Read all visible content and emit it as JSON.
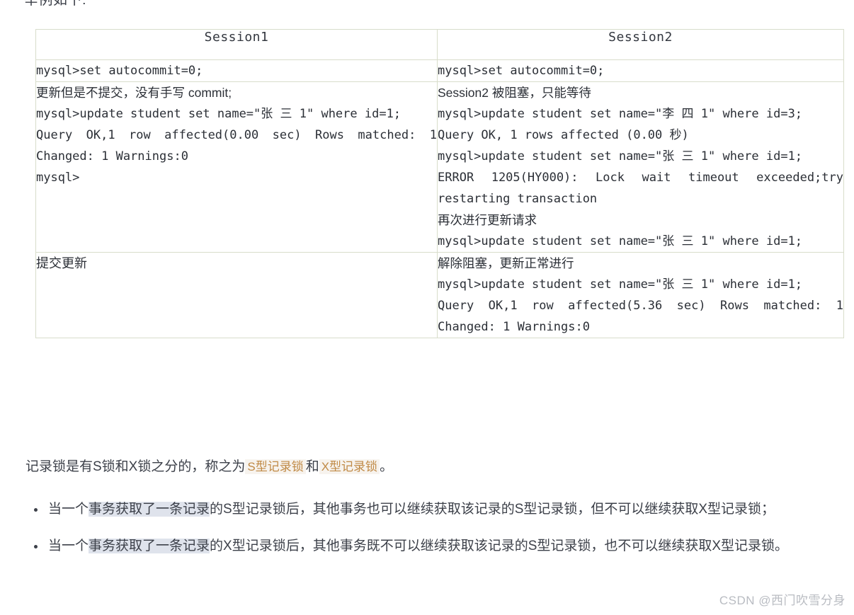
{
  "page": {
    "top_clipped_line": "举例如下:",
    "watermark": "CSDN @西门吹雪分身"
  },
  "table": {
    "headers": {
      "session1": "Session1",
      "session2": "Session2"
    },
    "rows": [
      {
        "left": {
          "lines": [
            "mysql>set autocommit=0;"
          ]
        },
        "right": {
          "lines": [
            "mysql>set autocommit=0;"
          ]
        }
      },
      {
        "left": {
          "note": "更新但是不提交，没有手写 commit;",
          "code1": "mysql>update student set name=\"张 三 1\" where id=1;",
          "code2": "Query OK,1 row affected(0.00 sec) Rows matched: 1 Changed: 1 Warnings:0",
          "code3": "mysql>"
        },
        "right": {
          "note1": "Session2 被阻塞，只能等待",
          "code1": "mysql>update student set name=\"李 四 1\" where id=3;",
          "code2": "Query OK, 1 rows affected (0.00 秒)",
          "code3": "mysql>update student set name=\"张 三 1\" where id=1;",
          "code4": "ERROR 1205(HY000): Lock wait timeout exceeded;try restarting transaction",
          "note2": "再次进行更新请求",
          "code5": "mysql>update student set name=\"张 三 1\" where id=1;"
        }
      },
      {
        "left": {
          "note": "提交更新"
        },
        "right": {
          "note1": "解除阻塞，更新正常进行",
          "code1": "mysql>update student set name=\"张 三 1\" where id=1;",
          "code2": "Query OK,1 row affected(5.36 sec) Rows matched: 1 Changed: 1 Warnings:0"
        }
      }
    ]
  },
  "lead_paragraph": {
    "before": "记录锁是有S锁和X锁之分的，称之为",
    "highlight1": "S型记录锁",
    "middle": "和",
    "highlight2": "X型记录锁",
    "after": "。"
  },
  "bullets": [
    {
      "part1": "当一个",
      "selected": "事务获取了一条记录",
      "part2": "的S型记录锁后，其他事务也可以继续获取该记录的S型记录锁，但不可以继续获取X型记录锁；"
    },
    {
      "part1": "当一个",
      "selected": "事务获取了一条记录",
      "part2": "的X型记录锁后，其他事务既不可以继续获取该记录的S型记录锁，也不可以继续获取X型记录锁。"
    }
  ],
  "colors": {
    "table_border": "#d8ddcb",
    "highlight_text": "#c08a46",
    "highlight_bg": "#f7f3ee",
    "selection_bg": "#dfe3ec",
    "body_text": "#3c4049",
    "watermark": "#b9bcc2"
  }
}
